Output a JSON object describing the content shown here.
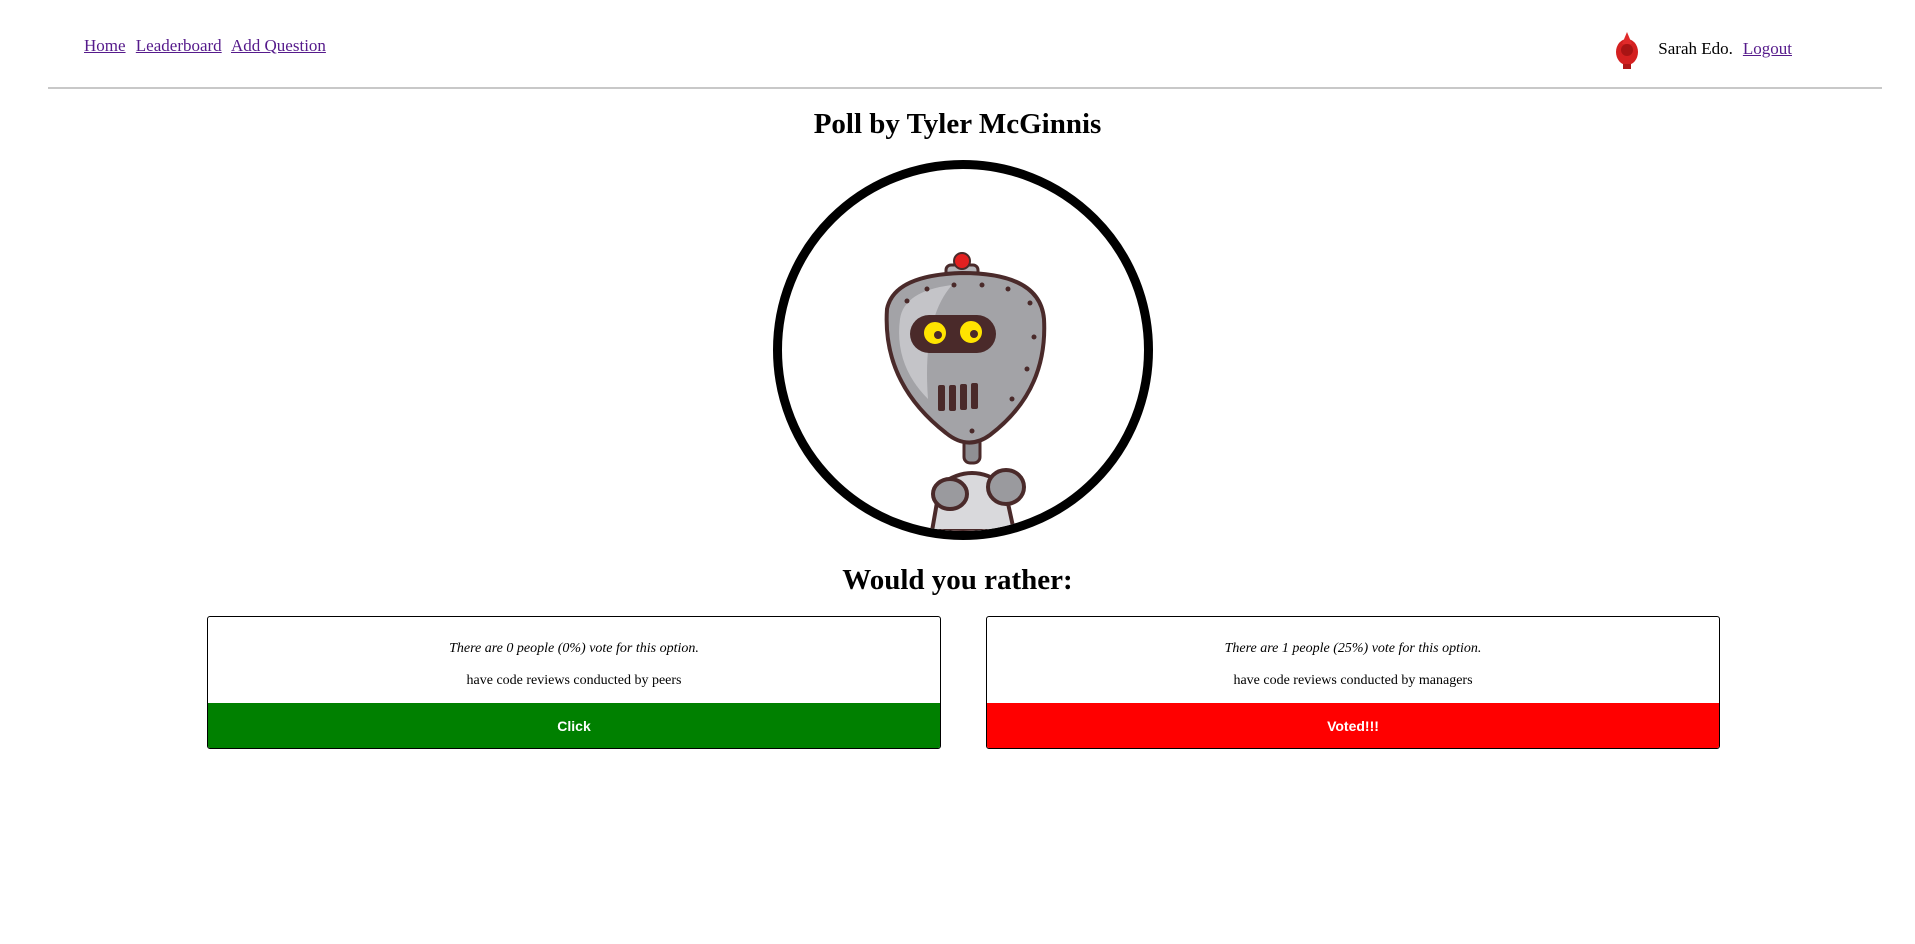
{
  "nav": {
    "links": [
      "Home",
      "Leaderboard",
      "Add Question"
    ],
    "user_name": "Sarah Edo.",
    "logout_label": "Logout"
  },
  "poll": {
    "title": "Poll by Tyler McGinnis",
    "question_heading": "Would you rather:",
    "options": [
      {
        "stats": "There are 0 people (0%) vote for this option.",
        "text": "have code reviews conducted by peers",
        "button_label": "Click",
        "button_color": "#008000"
      },
      {
        "stats": "There are 1 people (25%) vote for this option.",
        "text": "have code reviews conducted by managers",
        "button_label": "Voted!!!",
        "button_color": "#ff0000"
      }
    ]
  },
  "icons": {
    "user_avatar": "red-bird-avatar-icon",
    "poll_avatar": "robot-avatar"
  }
}
